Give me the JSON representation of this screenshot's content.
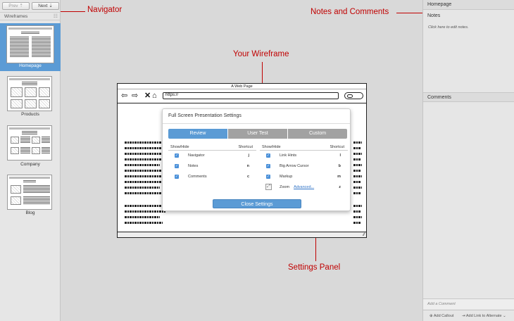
{
  "navigator": {
    "prev_label": "Prev ⇡",
    "next_label": "Next ⇣",
    "section_title": "Wireframes",
    "view_icon": "list-view-icon",
    "pages": [
      {
        "label": "Homepage",
        "selected": true
      },
      {
        "label": "Products",
        "selected": false
      },
      {
        "label": "Company",
        "selected": false
      },
      {
        "label": "Blog",
        "selected": false
      }
    ]
  },
  "right_panel": {
    "page_title": "Homepage",
    "notes_label": "Notes",
    "notes_hint": "Click here to edit notes.",
    "comments_title": "Comments",
    "add_comment_placeholder": "Add a Comment",
    "add_callout_label": "Add Callout",
    "add_link_label": "Add Link to Alternate"
  },
  "annotations": {
    "navigator": "Navigator",
    "notes_comments": "Notes and Comments",
    "wireframe": "Your Wireframe",
    "settings_panel": "Settings Panel"
  },
  "browser": {
    "title": "A Web Page",
    "url": "https://"
  },
  "settings": {
    "title": "Full Screen Presentation Settings",
    "tabs": [
      {
        "label": "Review",
        "active": true
      },
      {
        "label": "User Test",
        "active": false
      },
      {
        "label": "Custom",
        "active": false
      }
    ],
    "col_show_hide": "Show/Hide",
    "col_shortcut": "Shortcut",
    "left_rows": [
      {
        "name": "Navigator",
        "key": "j",
        "checked": true
      },
      {
        "name": "Notes",
        "key": "n",
        "checked": true
      },
      {
        "name": "Comments",
        "key": "c",
        "checked": true
      }
    ],
    "right_rows": [
      {
        "name": "Link Hints",
        "key": "l",
        "checked": true
      },
      {
        "name": "Big Arrow Cursor",
        "key": "b",
        "checked": true
      },
      {
        "name": "Markup",
        "key": "m",
        "checked": true
      }
    ],
    "zoom": {
      "name": "Zoom",
      "link": "Advanced...",
      "key": "z"
    },
    "close_label": "Close Settings"
  },
  "colors": {
    "accent": "#5b9bd5",
    "annotation": "#c00000"
  }
}
